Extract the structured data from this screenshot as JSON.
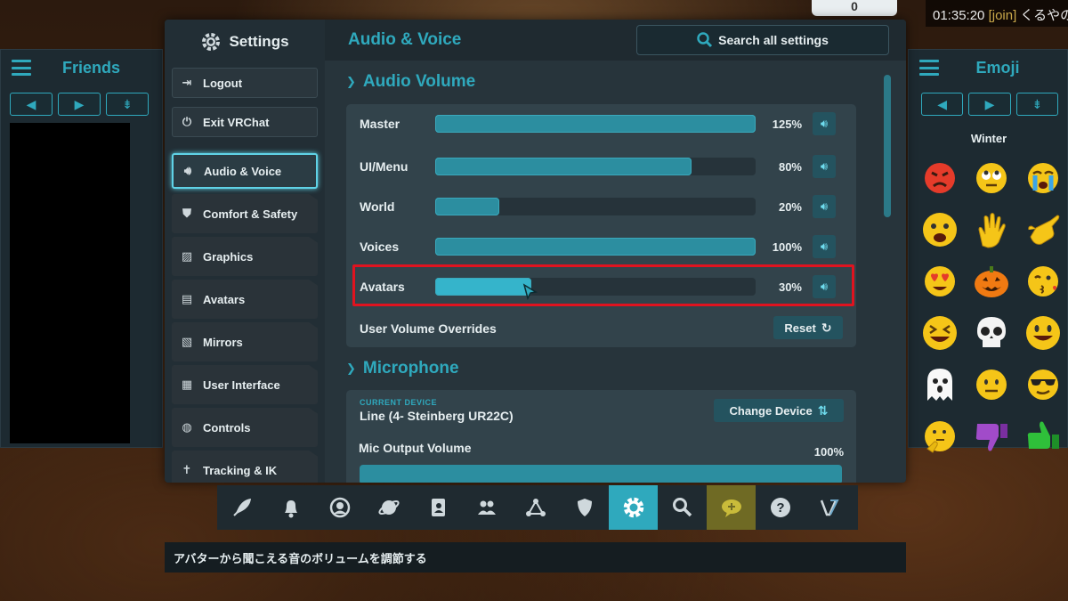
{
  "hud": {
    "time": "01:35:20",
    "join_tag": "[join]",
    "join_text": "くるやのぶ",
    "badge": "0"
  },
  "friends": {
    "title": "Friends"
  },
  "emoji_panel": {
    "title": "Emoji",
    "category": "Winter"
  },
  "settings": {
    "title": "Settings",
    "logout": "Logout",
    "exit": "Exit VRChat",
    "menu": [
      {
        "label": "Audio & Voice",
        "icon": "speaker-icon"
      },
      {
        "label": "Comfort & Safety",
        "icon": "shield-icon"
      },
      {
        "label": "Graphics",
        "icon": "image-icon"
      },
      {
        "label": "Avatars",
        "icon": "avatar-book-icon"
      },
      {
        "label": "Mirrors",
        "icon": "mirror-icon"
      },
      {
        "label": "User Interface",
        "icon": "keyboard-icon"
      },
      {
        "label": "Controls",
        "icon": "gamepad-icon"
      },
      {
        "label": "Tracking & IK",
        "icon": "person-icon"
      }
    ]
  },
  "main": {
    "title": "Audio & Voice",
    "search_label": "Search all settings",
    "audio_volume": {
      "heading": "Audio Volume",
      "sliders": [
        {
          "label": "Master",
          "value": "125%",
          "fraction": 1.0
        },
        {
          "label": "UI/Menu",
          "value": "80%",
          "fraction": 0.8
        },
        {
          "label": "World",
          "value": "20%",
          "fraction": 0.2
        },
        {
          "label": "Voices",
          "value": "100%",
          "fraction": 1.0
        },
        {
          "label": "Avatars",
          "value": "30%",
          "fraction": 0.3
        }
      ],
      "override_label": "User Volume Overrides",
      "reset_label": "Reset"
    },
    "microphone": {
      "heading": "Microphone",
      "current_device_label": "CURRENT DEVICE",
      "device_name": "Line (4- Steinberg UR22C)",
      "change_device": "Change Device",
      "mic_output_label": "Mic Output Volume",
      "mic_output_value": "100%"
    }
  },
  "dock_items": [
    "rocket-icon",
    "bell-icon",
    "user-circle-icon",
    "planet-icon",
    "avatar-book-icon",
    "people-icon",
    "network-icon",
    "shield-icon",
    "gear-icon",
    "search-icon",
    "chat-icon",
    "help-icon",
    "vrchat-logo-icon"
  ],
  "tooltip": "アバターから聞こえる音のボリュームを調節する",
  "colors": {
    "accent": "#2fa9bd",
    "highlight_box": "#e0131f"
  }
}
